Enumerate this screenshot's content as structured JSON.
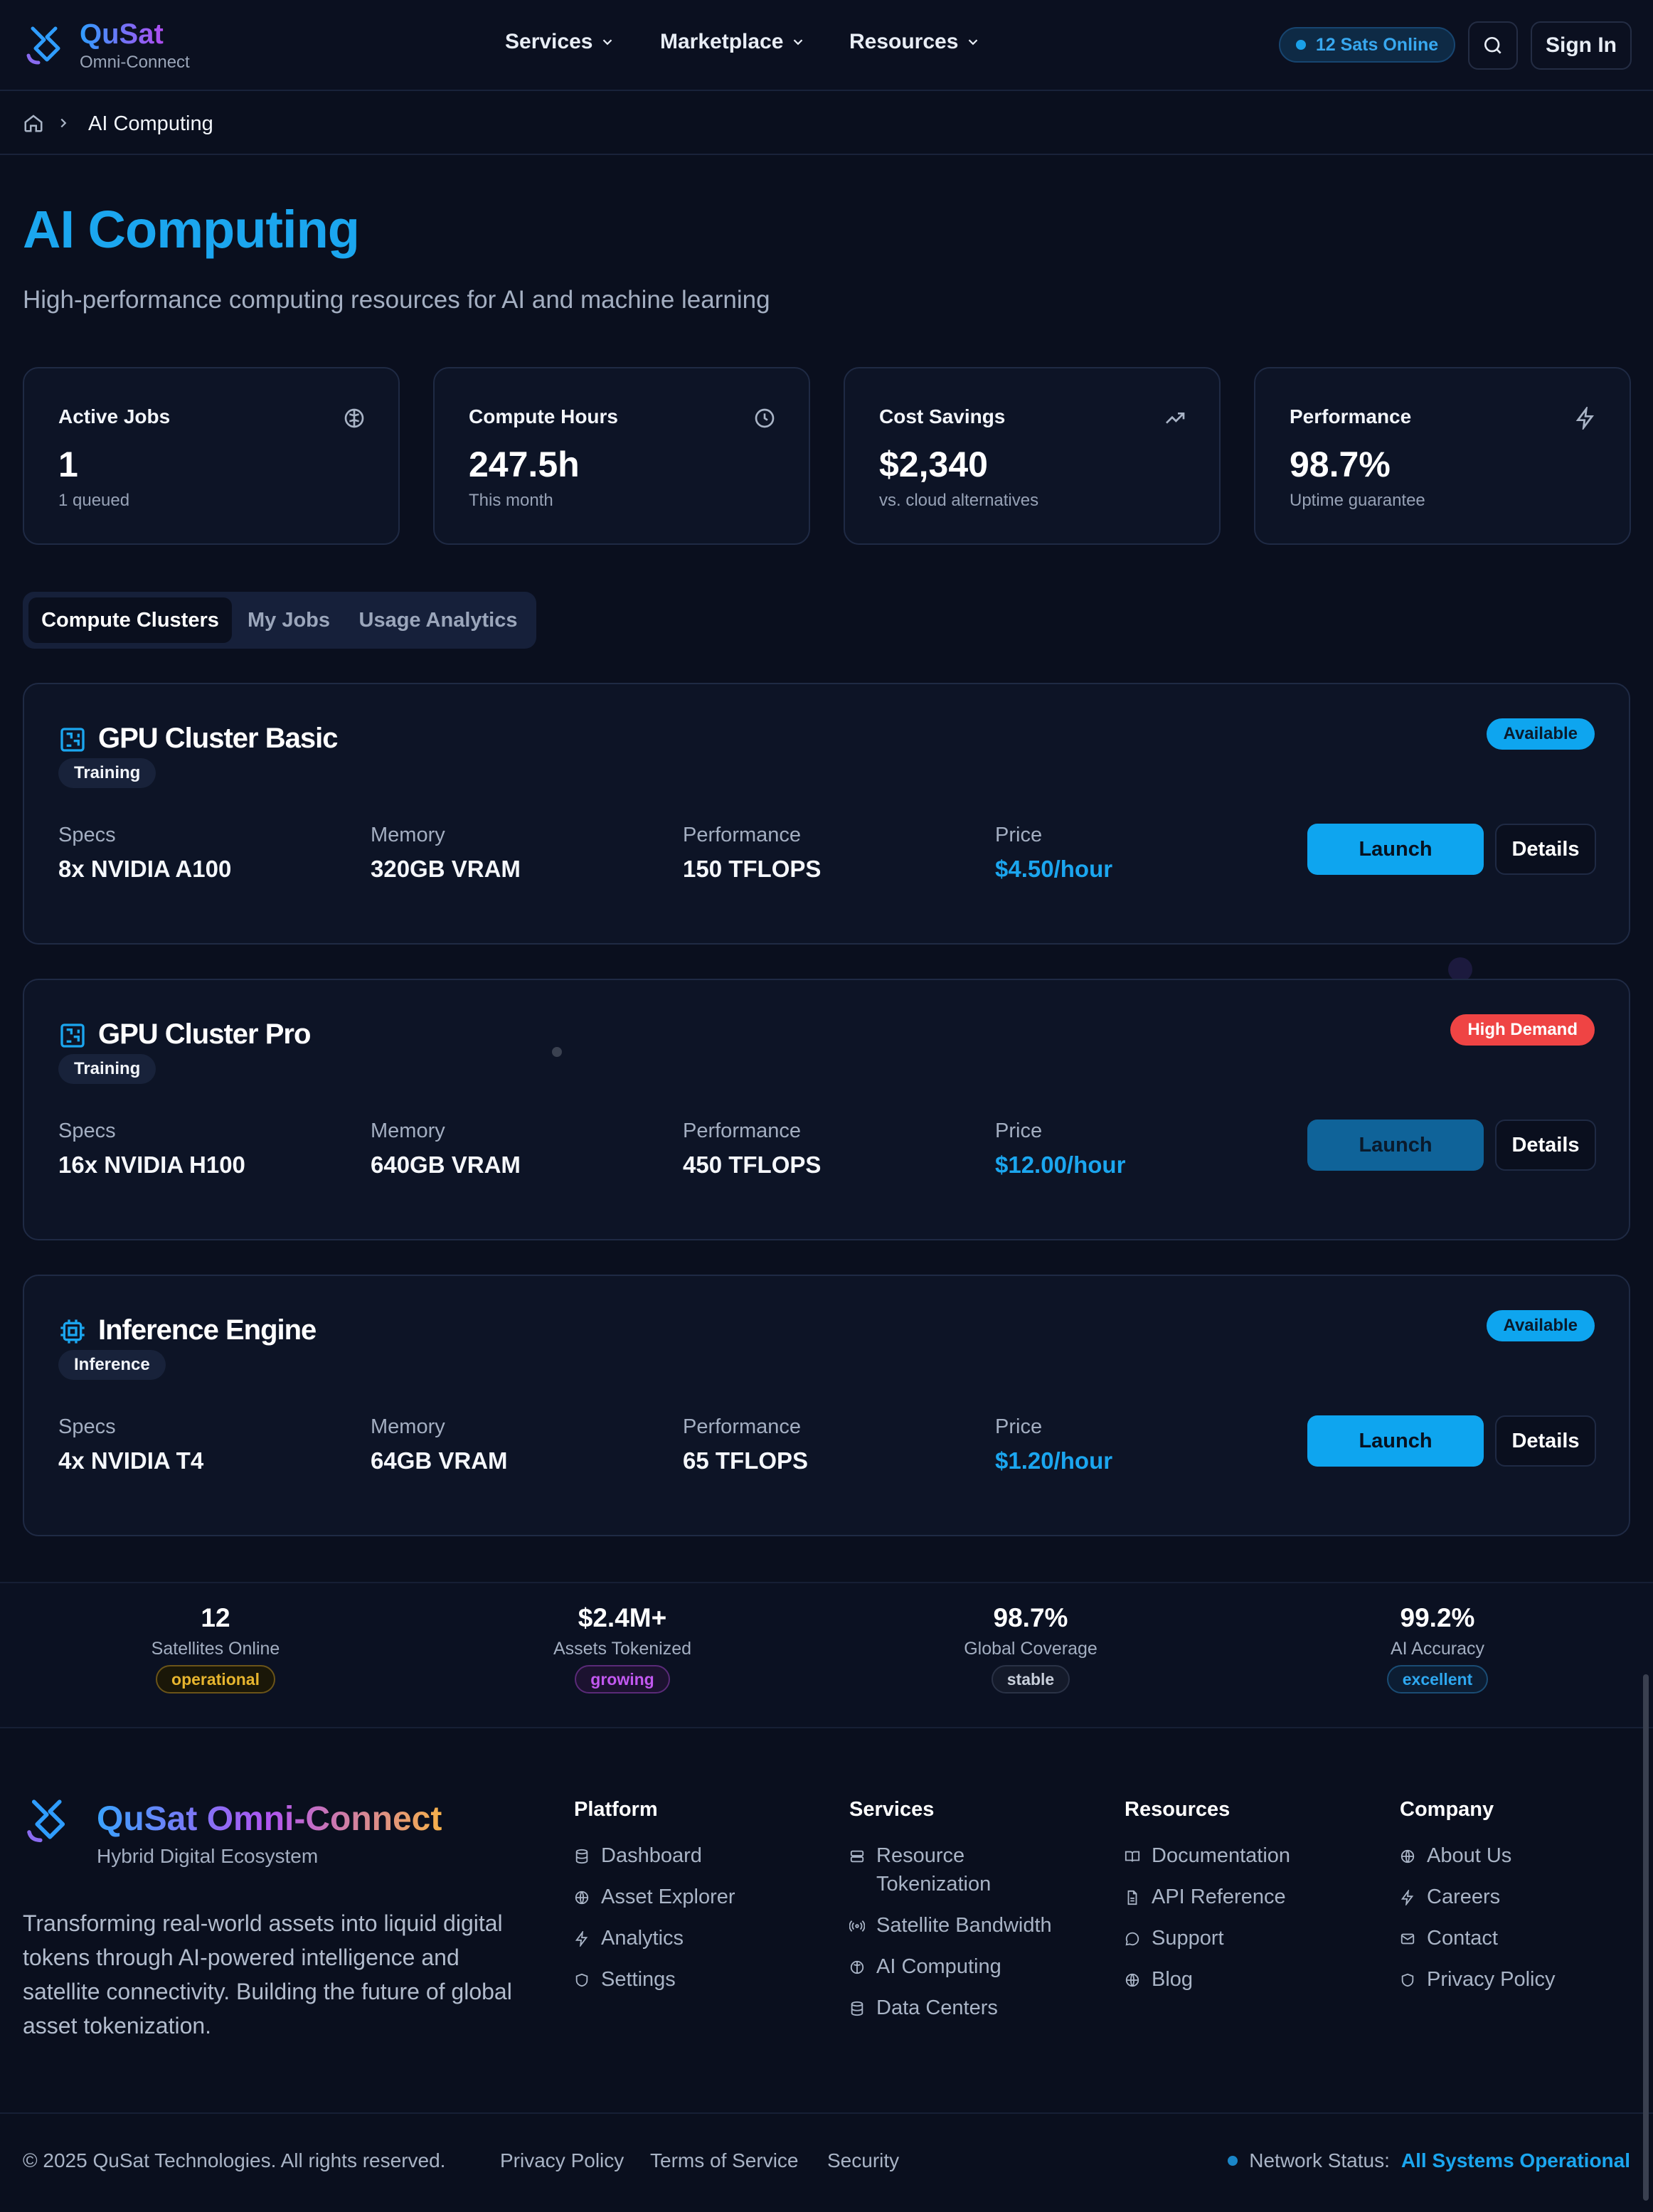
{
  "header": {
    "brand": "QuSat",
    "brand_sub": "Omni-Connect",
    "nav": [
      "Services",
      "Marketplace",
      "Resources"
    ],
    "sats_online": "12 Sats Online",
    "sign_in": "Sign In"
  },
  "breadcrumb": {
    "current": "AI Computing"
  },
  "page": {
    "title": "AI Computing",
    "subtitle": "High-performance computing resources for AI and machine learning"
  },
  "stats": [
    {
      "label": "Active Jobs",
      "value": "1",
      "note": "1 queued",
      "icon": "brain-icon"
    },
    {
      "label": "Compute Hours",
      "value": "247.5h",
      "note": "This month",
      "icon": "clock-icon"
    },
    {
      "label": "Cost Savings",
      "value": "$2,340",
      "note": "vs. cloud alternatives",
      "icon": "trending-up-icon"
    },
    {
      "label": "Performance",
      "value": "98.7%",
      "note": "Uptime guarantee",
      "icon": "zap-icon"
    }
  ],
  "tabs": [
    "Compute Clusters",
    "My Jobs",
    "Usage Analytics"
  ],
  "spec_labels": {
    "specs": "Specs",
    "memory": "Memory",
    "performance": "Performance",
    "price": "Price"
  },
  "clusters": [
    {
      "name": "GPU Cluster Basic",
      "tag": "Training",
      "status": "Available",
      "specs": "8x NVIDIA A100",
      "memory": "320GB VRAM",
      "performance": "150 TFLOPS",
      "price": "$4.50/hour",
      "launch": "Launch",
      "details": "Details"
    },
    {
      "name": "GPU Cluster Pro",
      "tag": "Training",
      "status": "High Demand",
      "specs": "16x NVIDIA H100",
      "memory": "640GB VRAM",
      "performance": "450 TFLOPS",
      "price": "$12.00/hour",
      "launch": "Launch",
      "details": "Details"
    },
    {
      "name": "Inference Engine",
      "tag": "Inference",
      "status": "Available",
      "specs": "4x NVIDIA T4",
      "memory": "64GB VRAM",
      "performance": "65 TFLOPS",
      "price": "$1.20/hour",
      "launch": "Launch",
      "details": "Details"
    }
  ],
  "metrics": [
    {
      "value": "12",
      "label": "Satellites Online",
      "badge": "operational",
      "color": "#e7b52e"
    },
    {
      "value": "$2.4M+",
      "label": "Assets Tokenized",
      "badge": "growing",
      "color": "#c258f0"
    },
    {
      "value": "98.7%",
      "label": "Global Coverage",
      "badge": "stable",
      "color": "#c8cfdb"
    },
    {
      "value": "99.2%",
      "label": "AI Accuracy",
      "badge": "excellent",
      "color": "#2ea7ef"
    }
  ],
  "footer": {
    "title": "QuSat Omni-Connect",
    "tagline": "Hybrid Digital Ecosystem",
    "description": "Transforming real-world assets into liquid digital tokens through AI-powered intelligence and satellite connectivity. Building the future of global asset tokenization.",
    "columns": [
      {
        "heading": "Platform",
        "items": [
          "Dashboard",
          "Asset Explorer",
          "Analytics",
          "Settings"
        ]
      },
      {
        "heading": "Services",
        "items": [
          "Resource Tokenization",
          "Satellite Bandwidth",
          "AI Computing",
          "Data Centers"
        ]
      },
      {
        "heading": "Resources",
        "items": [
          "Documentation",
          "API Reference",
          "Support",
          "Blog"
        ]
      },
      {
        "heading": "Company",
        "items": [
          "About Us",
          "Careers",
          "Contact",
          "Privacy Policy"
        ]
      }
    ],
    "copyright": "© 2025 QuSat Technologies. All rights reserved.",
    "links": [
      "Privacy Policy",
      "Terms of Service",
      "Security"
    ],
    "network_label": "Network Status:",
    "network_value": "All Systems Operational"
  }
}
